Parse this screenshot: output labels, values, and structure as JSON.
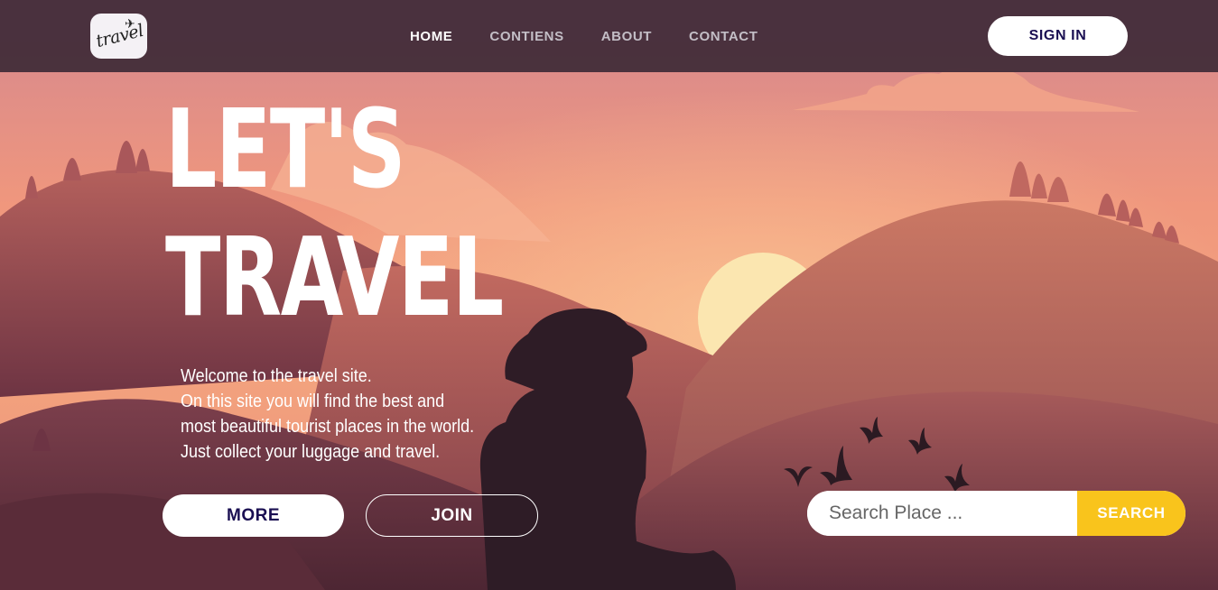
{
  "logo": {
    "text": "travel",
    "icon": "airplane-icon"
  },
  "nav": {
    "items": [
      {
        "label": "HOME",
        "active": true
      },
      {
        "label": "CONTIENS",
        "active": false
      },
      {
        "label": "ABOUT",
        "active": false
      },
      {
        "label": "CONTACT",
        "active": false
      }
    ],
    "signin_label": "SIGN IN"
  },
  "hero": {
    "title_line1": "LET'S",
    "title_line2": "TRAVEL",
    "intro_lines": [
      "Welcome to the travel site.",
      "On this site you will find the best and",
      "most beautiful tourist places in the world.",
      "Just collect your luggage and travel."
    ],
    "more_label": "MORE",
    "join_label": "JOIN"
  },
  "search": {
    "placeholder": "Search Place ...",
    "value": "",
    "button_label": "SEARCH"
  },
  "colors": {
    "navbar": "#442e3a",
    "accent_dark": "#1a0f52",
    "search_button": "#f9c41c",
    "sky_top": "#d88a8c",
    "sun": "#fbe6b0"
  }
}
